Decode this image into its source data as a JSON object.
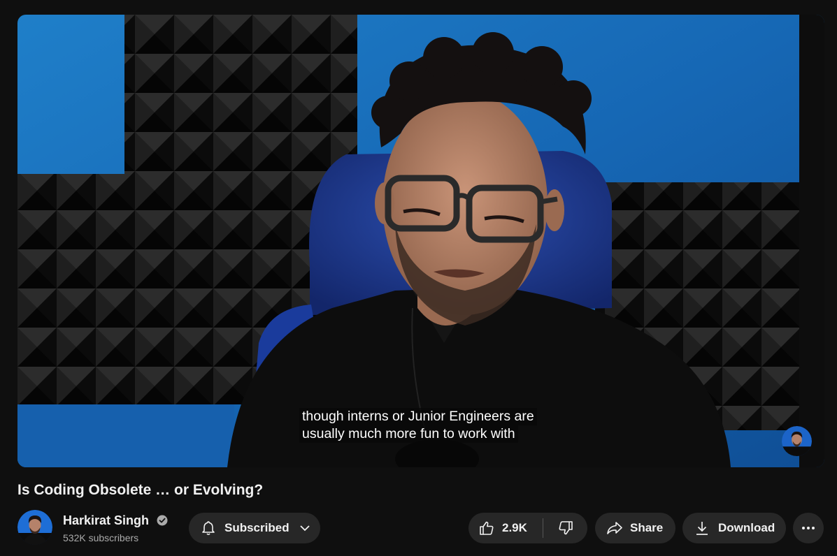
{
  "video": {
    "captions": [
      "though interns or Junior Engineers are",
      "usually much more fun to work with"
    ],
    "watermark_icon": "channel-watermark-avatar"
  },
  "title": "Is Coding Obsolete … or Evolving?",
  "channel": {
    "name": "Harkirat Singh",
    "verified_icon": "verified-check-icon",
    "subscribers": "532K subscribers"
  },
  "actions": {
    "subscribe_label": "Subscribed",
    "like_count": "2.9K",
    "share_label": "Share",
    "download_label": "Download"
  },
  "colors": {
    "background": "#0f0f0f",
    "button_bg": "#272727",
    "secondary_text": "#aaaaaa",
    "primary_text": "#f1f1f1"
  }
}
